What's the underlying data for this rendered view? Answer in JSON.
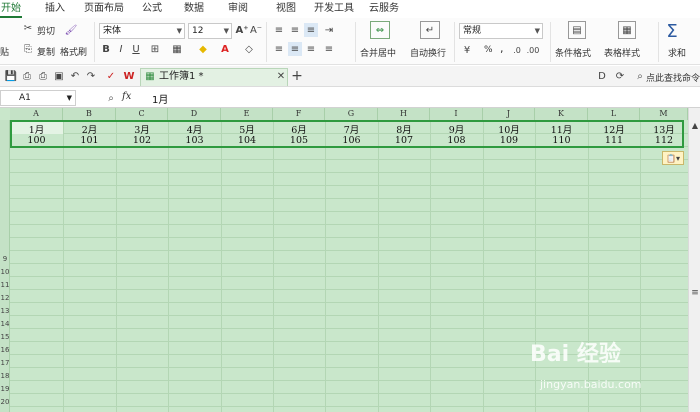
{
  "menu": {
    "tabs": [
      "开始",
      "插入",
      "页面布局",
      "公式",
      "数据",
      "审阅",
      "视图",
      "开发工具",
      "云服务"
    ],
    "active": "开始"
  },
  "ribbon": {
    "paste": "贴",
    "cut": "剪切",
    "copy": "复制",
    "format_painter": "格式刷",
    "font_name": "宋体",
    "font_size": "12",
    "merge_center": "合并居中",
    "wrap_text": "自动换行",
    "number_format": "常规",
    "conditional_format": "条件格式",
    "table_style": "表格样式",
    "sum": "求和",
    "percent": "%",
    "thousands": ","
  },
  "quickbar": {
    "doc_tab": "工作簿1 *",
    "search": "点此查找命令"
  },
  "formula_bar": {
    "cell_ref": "A1",
    "fx": "fx",
    "value": "1月"
  },
  "sheet": {
    "columns": [
      "A",
      "B",
      "C",
      "D",
      "E",
      "F",
      "G",
      "H",
      "I",
      "J",
      "K",
      "L",
      "M"
    ],
    "row1": [
      "1月",
      "2月",
      "3月",
      "4月",
      "5月",
      "6月",
      "7月",
      "8月",
      "9月",
      "10月",
      "11月",
      "12月",
      "13月"
    ],
    "row2": [
      "100",
      "101",
      "102",
      "103",
      "104",
      "105",
      "106",
      "107",
      "108",
      "109",
      "110",
      "111",
      "112"
    ],
    "row_numbers": [
      "9",
      "10",
      "11",
      "12",
      "13",
      "14",
      "15",
      "16",
      "17",
      "18",
      "19",
      "20"
    ]
  },
  "watermark": {
    "brand": "Bai 经验",
    "url": "jingyan.baidu.com"
  }
}
